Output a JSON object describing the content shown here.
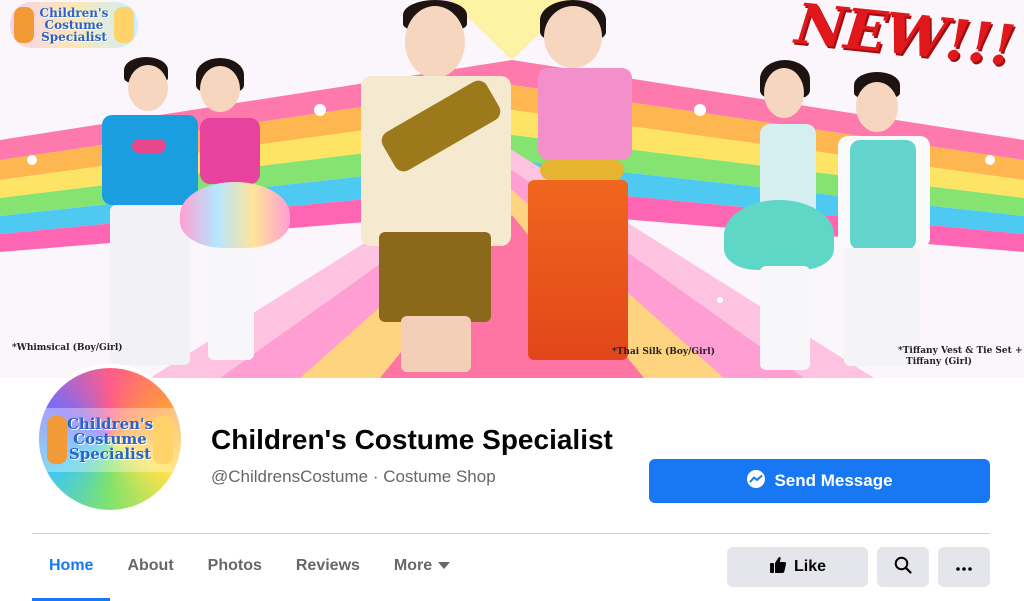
{
  "cover": {
    "logo_lines": [
      "Children's",
      "Costume",
      "Specialist"
    ],
    "new_badge": "NEW!!!",
    "captions": {
      "left": "*Whimsical (Boy/Girl)",
      "middle": "*Thai Silk (Boy/Girl)",
      "right_line1": "*Tiffany Vest & Tie Set +",
      "right_line2": "Tiffany (Girl)"
    }
  },
  "profile": {
    "avatar_lines": [
      "Children's",
      "Costume",
      "Specialist"
    ],
    "name": "Children's Costume Specialist",
    "subtitle": "@ChildrensCostume · Costume Shop"
  },
  "actions": {
    "send_message": "Send Message",
    "like": "Like"
  },
  "tabs": [
    {
      "label": "Home",
      "active": true
    },
    {
      "label": "About",
      "active": false
    },
    {
      "label": "Photos",
      "active": false
    },
    {
      "label": "Reviews",
      "active": false
    },
    {
      "label": "More",
      "active": false
    }
  ],
  "colors": {
    "accent": "#1877f2",
    "button_grey": "#e4e6eb",
    "secondary_text": "#65676b",
    "new_red": "#e0181c"
  },
  "icons": {
    "send_message": "messenger-icon",
    "like": "thumbs-up-icon",
    "search": "search-icon",
    "more": "ellipsis-icon",
    "tab_more": "caret-down-icon"
  }
}
